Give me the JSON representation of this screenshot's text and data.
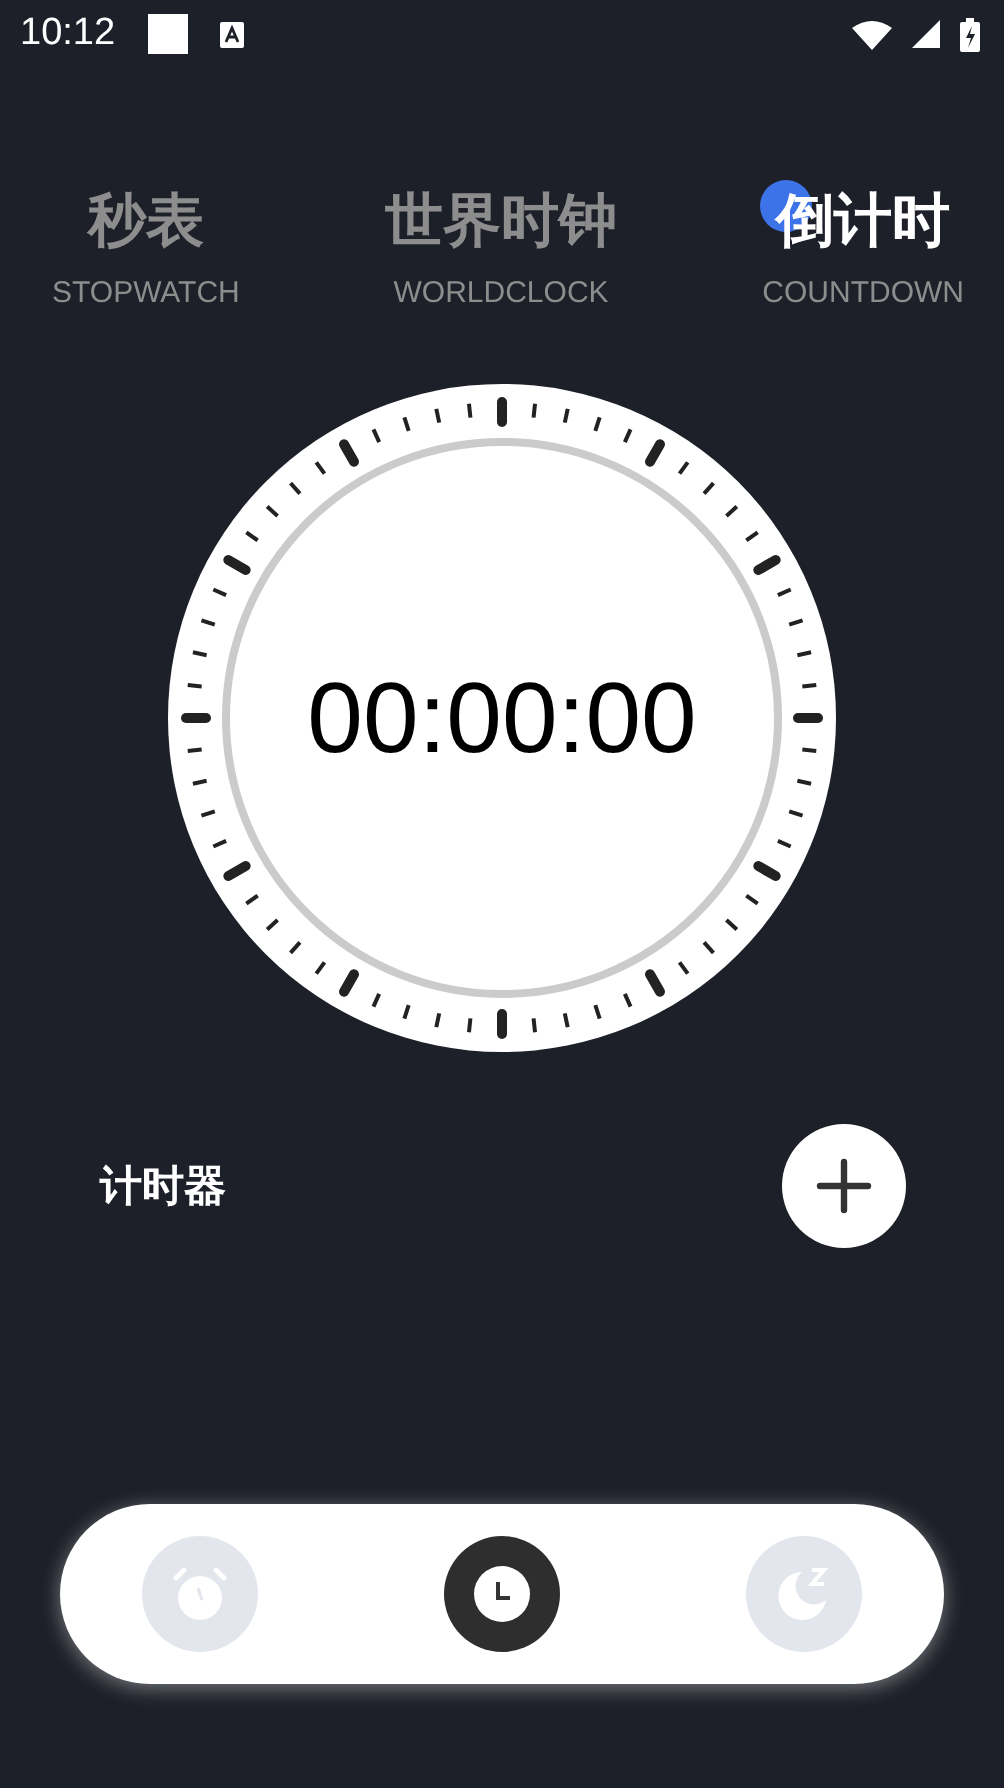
{
  "status_bar": {
    "time": "10:12"
  },
  "tabs": [
    {
      "title": "秒表",
      "subtitle": "STOPWATCH",
      "selected": false,
      "badge": false
    },
    {
      "title": "世界时钟",
      "subtitle": "WORLDCLOCK",
      "selected": false,
      "badge": false
    },
    {
      "title": "倒计时",
      "subtitle": "COUNTDOWN",
      "selected": true,
      "badge": true
    }
  ],
  "timer": {
    "display": "00:00:00"
  },
  "timers_section": {
    "label": "计时器"
  },
  "bottom_nav": [
    {
      "kind": "alarm",
      "selected": false
    },
    {
      "kind": "clock",
      "selected": true
    },
    {
      "kind": "sleep",
      "selected": false
    }
  ]
}
